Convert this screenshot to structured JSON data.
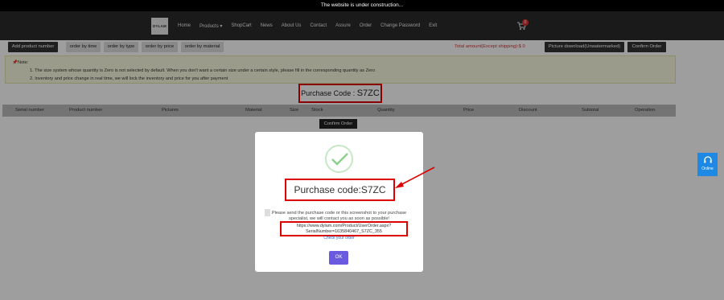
{
  "banner": "The website is under construction...",
  "logo_text": "DYLAM",
  "nav": [
    "Home",
    "Products ▾",
    "ShopCart",
    "News",
    "About Us",
    "Contact",
    "Assure",
    "Order",
    "Change Password",
    "Exit"
  ],
  "cart_count": "0",
  "toolbar": {
    "add_product": "Add product number",
    "sort": [
      "order by time",
      "order by type",
      "order by price",
      "order by material"
    ],
    "total_label": "Total amount(Except shipping):$",
    "total_value": "0",
    "picture_download": "Picture download(Unwatermarked)",
    "confirm_order": "Confirm Order"
  },
  "note": {
    "title": "Note:",
    "lines": [
      "1. The size system whose quantity is Zero is not selected by default. When you don't want a certain size under a certain style, please fill in the corresponding quantity as Zero",
      "2. Inventory and price change in real time, we will lock the inventory and price for you after payment"
    ]
  },
  "purchase_code": {
    "label": "Purchase Code :",
    "value": "S7ZC"
  },
  "table_headers": [
    "Serial number",
    "Product number",
    "Pictures",
    "Material",
    "Size",
    "Stock",
    "Quantity",
    "Price",
    "Discount",
    "Subtotal",
    "Operation"
  ],
  "confirm_order_small": "Confirm Order",
  "online_label": "Online",
  "modal": {
    "code_text": "Purchase code:S7ZC",
    "message": "Please send the purchase code or this screenshot to your purchase specialist, we will contact you as soon as possible!",
    "url_line1": "https://www.dylam.com/Product/UserOrder.aspx?",
    "url_line2": "SerialNumber=1635840467_S7ZC_355",
    "check_link": "Check your order",
    "ok": "OK"
  },
  "colors": {
    "accent_red": "#dd0000",
    "ok_button": "#6a5ae0",
    "online": "#1e88e5"
  }
}
